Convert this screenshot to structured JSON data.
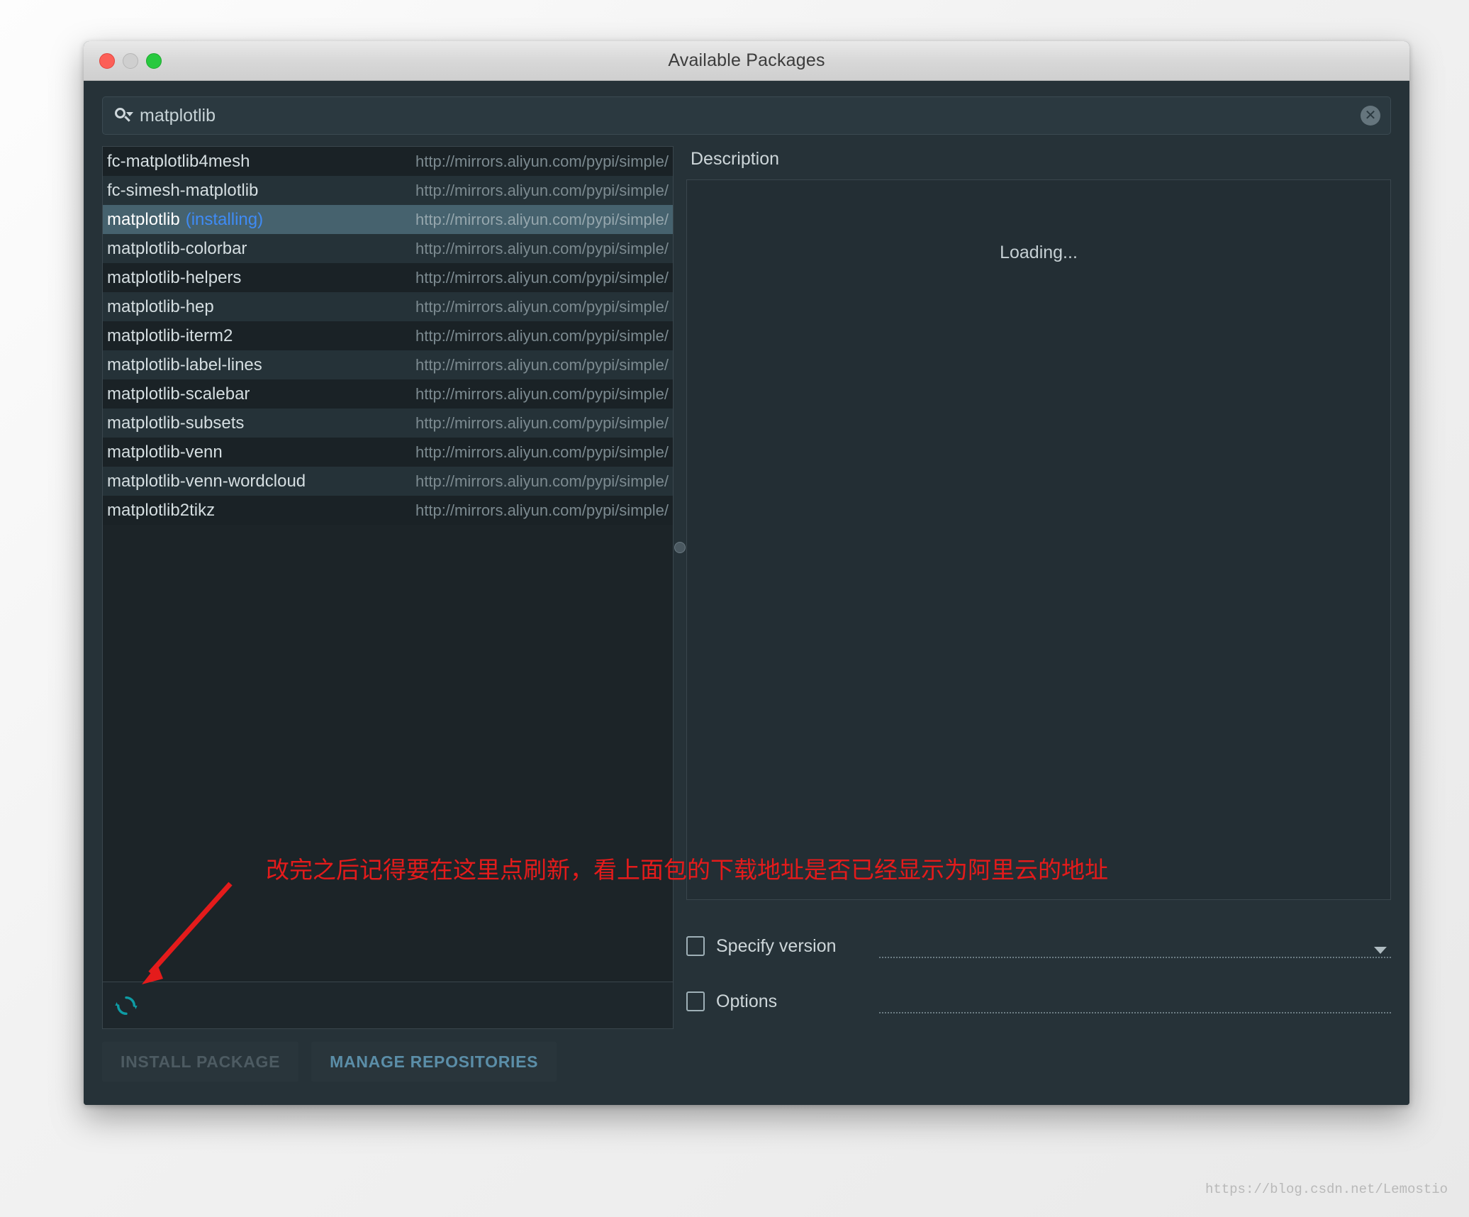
{
  "window": {
    "title": "Available Packages",
    "traffic_lights": [
      "close",
      "minimize",
      "zoom"
    ]
  },
  "search": {
    "value": "matplotlib",
    "placeholder": "",
    "icon": "search-icon",
    "clear_icon": "clear-icon"
  },
  "packages": {
    "columns": [
      "Name",
      "Repository"
    ],
    "rows": [
      {
        "name": "fc-matplotlib4mesh",
        "status": "",
        "url": "http://mirrors.aliyun.com/pypi/simple/",
        "selected": false
      },
      {
        "name": "fc-simesh-matplotlib",
        "status": "",
        "url": "http://mirrors.aliyun.com/pypi/simple/",
        "selected": false
      },
      {
        "name": "matplotlib",
        "status": "(installing)",
        "url": "http://mirrors.aliyun.com/pypi/simple/",
        "selected": true
      },
      {
        "name": "matplotlib-colorbar",
        "status": "",
        "url": "http://mirrors.aliyun.com/pypi/simple/",
        "selected": false
      },
      {
        "name": "matplotlib-helpers",
        "status": "",
        "url": "http://mirrors.aliyun.com/pypi/simple/",
        "selected": false
      },
      {
        "name": "matplotlib-hep",
        "status": "",
        "url": "http://mirrors.aliyun.com/pypi/simple/",
        "selected": false
      },
      {
        "name": "matplotlib-iterm2",
        "status": "",
        "url": "http://mirrors.aliyun.com/pypi/simple/",
        "selected": false
      },
      {
        "name": "matplotlib-label-lines",
        "status": "",
        "url": "http://mirrors.aliyun.com/pypi/simple/",
        "selected": false
      },
      {
        "name": "matplotlib-scalebar",
        "status": "",
        "url": "http://mirrors.aliyun.com/pypi/simple/",
        "selected": false
      },
      {
        "name": "matplotlib-subsets",
        "status": "",
        "url": "http://mirrors.aliyun.com/pypi/simple/",
        "selected": false
      },
      {
        "name": "matplotlib-venn",
        "status": "",
        "url": "http://mirrors.aliyun.com/pypi/simple/",
        "selected": false
      },
      {
        "name": "matplotlib-venn-wordcloud",
        "status": "",
        "url": "http://mirrors.aliyun.com/pypi/simple/",
        "selected": false
      },
      {
        "name": "matplotlib2tikz",
        "status": "",
        "url": "http://mirrors.aliyun.com/pypi/simple/",
        "selected": false
      }
    ]
  },
  "refresh": {
    "icon": "refresh-icon",
    "tooltip": ""
  },
  "description": {
    "label": "Description",
    "content": "Loading..."
  },
  "options": {
    "specify_version": {
      "label": "Specify version",
      "checked": false,
      "value": ""
    },
    "options_row": {
      "label": "Options",
      "checked": false,
      "value": ""
    }
  },
  "footer": {
    "install_label": "INSTALL PACKAGE",
    "install_disabled": true,
    "manage_label": "MANAGE REPOSITORIES"
  },
  "annotation": {
    "text": "改完之后记得要在这里点刷新，看上面包的下载地址是否已经显示为阿里云的地址",
    "color": "#e41b1b"
  },
  "watermark": "https://blog.csdn.net/Lemostio",
  "colors": {
    "window_bg": "#263238",
    "list_bg": "#1c2428",
    "row_alt": "#253238",
    "selection": "#46626e",
    "accent_link": "#3f8bf5",
    "refresh_teal": "#0e9ca5",
    "annotation_red": "#e41b1b"
  }
}
